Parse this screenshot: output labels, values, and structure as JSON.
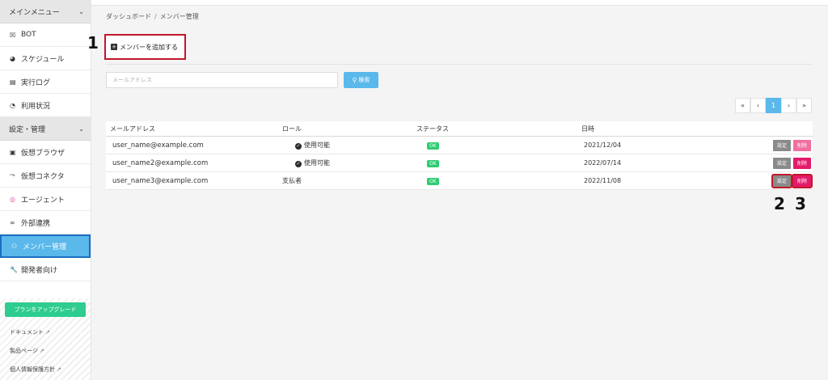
{
  "sidebar": {
    "main_menu": "メインメニュー",
    "main_items": [
      {
        "label": "BOT",
        "icon": "robot-icon"
      },
      {
        "label": "スケジュール",
        "icon": "clock-icon"
      },
      {
        "label": "実行ログ",
        "icon": "document-icon"
      },
      {
        "label": "利用状況",
        "icon": "pie-chart-icon"
      }
    ],
    "settings_menu": "設定・管理",
    "settings_items": [
      {
        "label": "仮想ブラウザ",
        "icon": "browser-icon"
      },
      {
        "label": "仮想コネクタ",
        "icon": "connector-icon"
      },
      {
        "label": "エージェント",
        "icon": "agent-icon"
      },
      {
        "label": "外部連携",
        "icon": "link-icon"
      },
      {
        "label": "メンバー管理",
        "icon": "users-icon"
      },
      {
        "label": "開発者向け",
        "icon": "wrench-icon"
      }
    ],
    "upgrade": "プランをアップグレード",
    "links": [
      "ドキュメント",
      "製品ページ",
      "個人情報保護方針"
    ]
  },
  "breadcrumb": {
    "root": "ダッシュボード",
    "sep": "/",
    "current": "メンバー管理"
  },
  "add_member": "メンバーを追加する",
  "search": {
    "placeholder": "メールアドレス",
    "button": "検索"
  },
  "pagination": {
    "first": "«",
    "prev": "‹",
    "current": "1",
    "next": "›",
    "last": "»"
  },
  "table": {
    "headers": {
      "email": "メールアドレス",
      "role": "ロール",
      "status": "ステータス",
      "date": "日時"
    },
    "rows": [
      {
        "email": "user_name@example.com",
        "role": "使用可能",
        "status": "OK",
        "date": "2021/12/04"
      },
      {
        "email": "user_name2@example.com",
        "role": "使用可能",
        "status": "OK",
        "date": "2022/07/14"
      },
      {
        "email": "user_name3@example.com",
        "role": "支払者",
        "status": "OK",
        "date": "2022/11/08"
      }
    ],
    "set_label": "設定",
    "del_label": "削除"
  },
  "annotations": {
    "one": "1",
    "two": "2",
    "three": "3"
  },
  "colors": {
    "accent": "#5bb8ea",
    "active_border": "#1a6fbf",
    "highlight": "#c0182a",
    "ok": "#2ecc71",
    "delete": "#f06ea0"
  }
}
